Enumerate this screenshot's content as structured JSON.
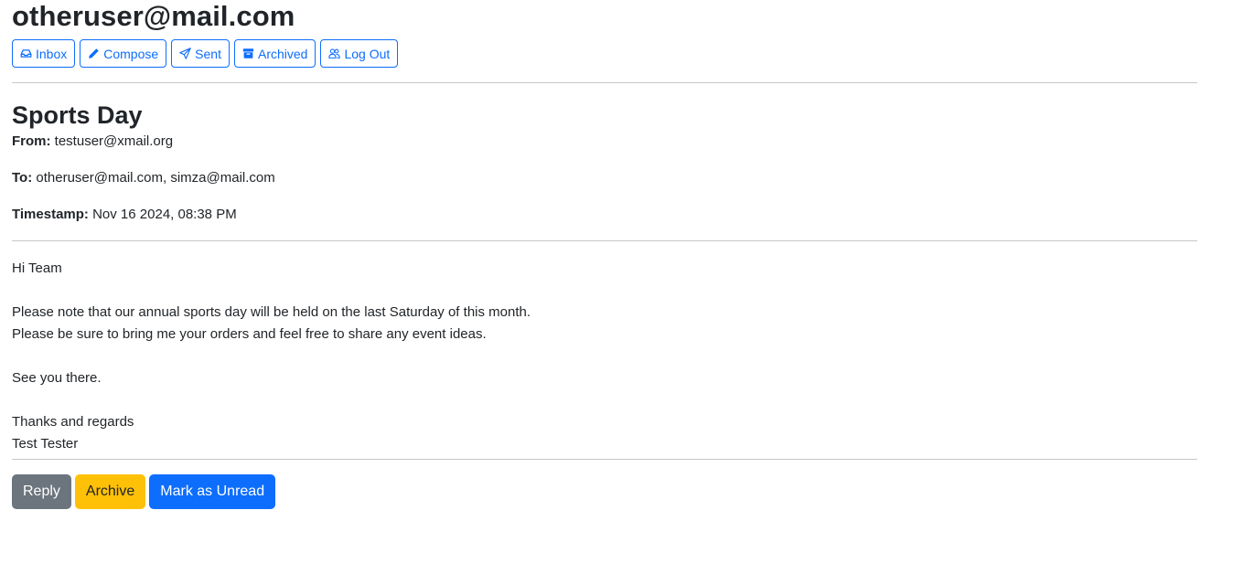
{
  "user": {
    "email": "otheruser@mail.com"
  },
  "nav": {
    "items": [
      {
        "label": "Inbox",
        "icon": "inbox-icon"
      },
      {
        "label": "Compose",
        "icon": "pencil-icon"
      },
      {
        "label": "Sent",
        "icon": "send-icon"
      },
      {
        "label": "Archived",
        "icon": "archive-icon"
      },
      {
        "label": "Log Out",
        "icon": "people-icon"
      }
    ],
    "color": "#0d6efd"
  },
  "email": {
    "subject": "Sports Day",
    "from_label": "From:",
    "from": "testuser@xmail.org",
    "to_label": "To:",
    "to": "otheruser@mail.com, simza@mail.com",
    "timestamp_label": "Timestamp:",
    "timestamp": "Nov 16 2024, 08:38 PM",
    "body": "Hi Team\n\nPlease note that our annual sports day will be held on the last Saturday of this month.\nPlease be sure to bring me your orders and feel free to share any event ideas.\n\nSee you there.\n\nThanks and regards\nTest Tester"
  },
  "actions": {
    "reply_label": "Reply",
    "archive_label": "Archive",
    "unread_label": "Mark as Unread",
    "colors": {
      "reply": "#6c757d",
      "archive": "#ffc107",
      "unread": "#0d6efd"
    }
  }
}
